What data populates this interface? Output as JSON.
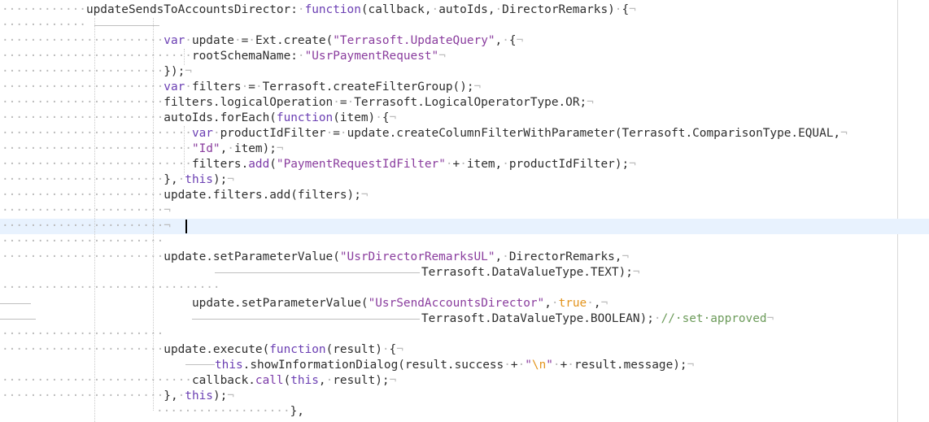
{
  "editor": {
    "lines": [
      {
        "indent": "············",
        "eol": "¬",
        "tokens": [
          {
            "t": "id",
            "v": "updateSendsToAccountsDirector:"
          },
          {
            "t": "ws",
            "v": "·"
          },
          {
            "t": "kw",
            "v": "function"
          },
          {
            "t": "id",
            "v": "(callback,"
          },
          {
            "t": "ws",
            "v": "·"
          },
          {
            "t": "id",
            "v": "autoIds,"
          },
          {
            "t": "ws",
            "v": "·"
          },
          {
            "t": "id",
            "v": "DirectorRemarks)"
          },
          {
            "t": "ws",
            "v": "·"
          },
          {
            "t": "id",
            "v": "{"
          }
        ]
      },
      {
        "indent": "············",
        "eol": "",
        "tokens": []
      },
      {
        "indent": "·······················",
        "eol": "¬",
        "tokens": [
          {
            "t": "kw",
            "v": "var"
          },
          {
            "t": "ws",
            "v": "·"
          },
          {
            "t": "id",
            "v": "update"
          },
          {
            "t": "ws",
            "v": "·"
          },
          {
            "t": "id",
            "v": "="
          },
          {
            "t": "ws",
            "v": "·"
          },
          {
            "t": "id",
            "v": "Ext.create("
          },
          {
            "t": "str",
            "v": "\"Terrasoft.UpdateQuery\""
          },
          {
            "t": "id",
            "v": ","
          },
          {
            "t": "ws",
            "v": "·"
          },
          {
            "t": "id",
            "v": "{"
          }
        ]
      },
      {
        "indent": "···························",
        "eol": "¬",
        "tokens": [
          {
            "t": "id",
            "v": "rootSchemaName:"
          },
          {
            "t": "ws",
            "v": "·"
          },
          {
            "t": "str",
            "v": "\"UsrPaymentRequest\""
          }
        ]
      },
      {
        "indent": "·······················",
        "eol": "¬",
        "tokens": [
          {
            "t": "id",
            "v": "});"
          }
        ]
      },
      {
        "indent": "·······················",
        "eol": "¬",
        "tokens": [
          {
            "t": "kw",
            "v": "var"
          },
          {
            "t": "ws",
            "v": "·"
          },
          {
            "t": "id",
            "v": "filters"
          },
          {
            "t": "ws",
            "v": "·"
          },
          {
            "t": "id",
            "v": "="
          },
          {
            "t": "ws",
            "v": "·"
          },
          {
            "t": "id",
            "v": "Terrasoft.createFilterGroup();"
          }
        ]
      },
      {
        "indent": "·······················",
        "eol": "¬",
        "tokens": [
          {
            "t": "id",
            "v": "filters.logicalOperation"
          },
          {
            "t": "ws",
            "v": "·"
          },
          {
            "t": "id",
            "v": "="
          },
          {
            "t": "ws",
            "v": "·"
          },
          {
            "t": "id",
            "v": "Terrasoft.LogicalOperatorType.OR;"
          }
        ]
      },
      {
        "indent": "·······················",
        "eol": "¬",
        "tokens": [
          {
            "t": "id",
            "v": "autoIds.forEach("
          },
          {
            "t": "kw",
            "v": "function"
          },
          {
            "t": "id",
            "v": "(item)"
          },
          {
            "t": "ws",
            "v": "·"
          },
          {
            "t": "id",
            "v": "{"
          }
        ]
      },
      {
        "indent": "···························",
        "eol": "¬",
        "tokens": [
          {
            "t": "kw",
            "v": "var"
          },
          {
            "t": "ws",
            "v": "·"
          },
          {
            "t": "id",
            "v": "productIdFilter"
          },
          {
            "t": "ws",
            "v": "·"
          },
          {
            "t": "id",
            "v": "="
          },
          {
            "t": "ws",
            "v": "·"
          },
          {
            "t": "id",
            "v": "update.createColumnFilterWithParameter(Terrasoft.ComparisonType.EQUAL,"
          }
        ]
      },
      {
        "indent": "···························",
        "eol": "¬",
        "tokens": [
          {
            "t": "str",
            "v": "\"Id\""
          },
          {
            "t": "id",
            "v": ","
          },
          {
            "t": "ws",
            "v": "·"
          },
          {
            "t": "id",
            "v": "item);"
          }
        ]
      },
      {
        "indent": "···························",
        "eol": "¬",
        "tokens": [
          {
            "t": "id",
            "v": "filters."
          },
          {
            "t": "fn",
            "v": "add"
          },
          {
            "t": "id",
            "v": "("
          },
          {
            "t": "str",
            "v": "\"PaymentRequestIdFilter\""
          },
          {
            "t": "ws",
            "v": "·"
          },
          {
            "t": "id",
            "v": "+"
          },
          {
            "t": "ws",
            "v": "·"
          },
          {
            "t": "id",
            "v": "item,"
          },
          {
            "t": "ws",
            "v": "·"
          },
          {
            "t": "id",
            "v": "productIdFilter);"
          }
        ]
      },
      {
        "indent": "·······················",
        "eol": "¬",
        "tokens": [
          {
            "t": "id",
            "v": "},"
          },
          {
            "t": "ws",
            "v": "·"
          },
          {
            "t": "kw",
            "v": "this"
          },
          {
            "t": "id",
            "v": ");"
          }
        ]
      },
      {
        "indent": "·······················",
        "eol": "¬",
        "tokens": [
          {
            "t": "id",
            "v": "update.filters.add(filters);"
          }
        ]
      },
      {
        "indent": "·······················",
        "eol": "¬",
        "tokens": []
      },
      {
        "indent": "·······················",
        "eol": "¬",
        "tokens": [],
        "active": true,
        "caret": true
      },
      {
        "indent": "·······················",
        "eol": "",
        "tokens": []
      },
      {
        "indent": "·······················",
        "eol": "¬",
        "tokens": [
          {
            "t": "id",
            "v": "update.setParameterValue("
          },
          {
            "t": "str",
            "v": "\"UsrDirectorRemarksUL\""
          },
          {
            "t": "id",
            "v": ","
          },
          {
            "t": "ws",
            "v": "·"
          },
          {
            "t": "id",
            "v": "DirectorRemarks,"
          }
        ]
      },
      {
        "indent": "",
        "eol": "¬",
        "tokens": [
          {
            "t": "id",
            "v": "Terrasoft.DataValueType.TEXT);"
          }
        ],
        "offset": 518
      },
      {
        "indent": "·······························",
        "eol": "",
        "tokens": []
      },
      {
        "indent": "",
        "eol": "¬",
        "tokens": [
          {
            "t": "id",
            "v": "update.setParameterValue("
          },
          {
            "t": "str",
            "v": "\"UsrSendAccountsDirector\""
          },
          {
            "t": "id",
            "v": ","
          },
          {
            "t": "ws",
            "v": "·"
          },
          {
            "t": "bool",
            "v": "true"
          },
          {
            "t": "ws",
            "v": "·"
          },
          {
            "t": "id",
            "v": ","
          }
        ],
        "offset": 236
      },
      {
        "indent": "",
        "eol": "¬",
        "tokens": [
          {
            "t": "id",
            "v": "Terrasoft.DataValueType.BOOLEAN);"
          },
          {
            "t": "ws",
            "v": "·"
          },
          {
            "t": "cmt",
            "v": "//·set·approved"
          }
        ],
        "offset": 518
      },
      {
        "indent": "·······················",
        "eol": "",
        "tokens": []
      },
      {
        "indent": "·······················",
        "eol": "¬",
        "tokens": [
          {
            "t": "id",
            "v": "update.execute("
          },
          {
            "t": "kw",
            "v": "function"
          },
          {
            "t": "id",
            "v": "(result)"
          },
          {
            "t": "ws",
            "v": "·"
          },
          {
            "t": "id",
            "v": "{"
          }
        ]
      },
      {
        "indent": "",
        "eol": "¬",
        "tokens": [
          {
            "t": "kw",
            "v": "this"
          },
          {
            "t": "id",
            "v": ".showInformationDialog(result.success"
          },
          {
            "t": "ws",
            "v": "·"
          },
          {
            "t": "id",
            "v": "+"
          },
          {
            "t": "ws",
            "v": "·"
          },
          {
            "t": "str",
            "v": "\""
          },
          {
            "t": "esc",
            "v": "\\n"
          },
          {
            "t": "str",
            "v": "\""
          },
          {
            "t": "ws",
            "v": "·"
          },
          {
            "t": "id",
            "v": "+"
          },
          {
            "t": "ws",
            "v": "·"
          },
          {
            "t": "id",
            "v": "result.message);"
          }
        ],
        "offset": 264
      },
      {
        "indent": "···························",
        "eol": "¬",
        "tokens": [
          {
            "t": "id",
            "v": "callback."
          },
          {
            "t": "fn",
            "v": "call"
          },
          {
            "t": "id",
            "v": "("
          },
          {
            "t": "kw",
            "v": "this"
          },
          {
            "t": "id",
            "v": ","
          },
          {
            "t": "ws",
            "v": "·"
          },
          {
            "t": "id",
            "v": "result);"
          }
        ]
      },
      {
        "indent": "·······················",
        "eol": "¬",
        "tokens": [
          {
            "t": "id",
            "v": "},"
          },
          {
            "t": "ws",
            "v": "·"
          },
          {
            "t": "kw",
            "v": "this"
          },
          {
            "t": "id",
            "v": ");"
          }
        ]
      },
      {
        "indent": "···················",
        "eol": "",
        "tokens": [
          {
            "t": "id",
            "v": "},"
          }
        ],
        "offset": 192
      },
      {
        "indent": "",
        "eol": "",
        "tokens": [],
        "offset": 118
      }
    ]
  }
}
